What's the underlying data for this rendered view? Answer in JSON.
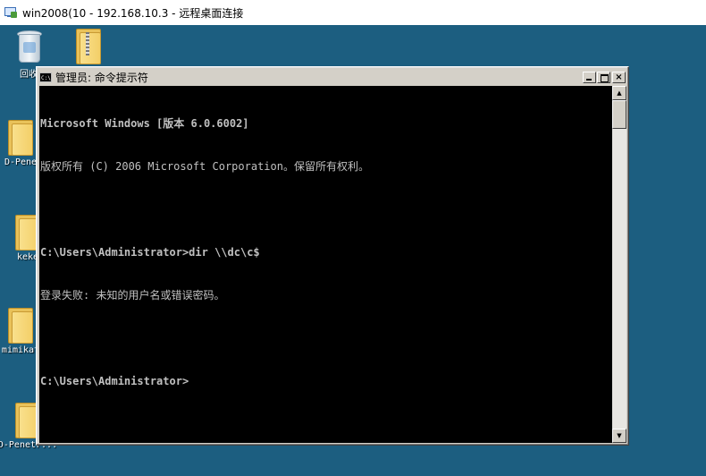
{
  "rdp": {
    "title": "win2008(10 - 192.168.10.3 - 远程桌面连接"
  },
  "desktop": {
    "background_color": "#1c5e80",
    "icons": [
      {
        "label": "回收",
        "icon": "recycle-bin-icon"
      },
      {
        "label": "",
        "icon": "zip-folder-icon"
      },
      {
        "label": "D-Pene",
        "icon": "folder-icon"
      },
      {
        "label": "keke",
        "icon": "folder-icon"
      },
      {
        "label": "mimikat",
        "icon": "folder-icon"
      },
      {
        "label": "D-Penetr...",
        "icon": "folder-icon"
      }
    ]
  },
  "cmd": {
    "title": "管理员: 命令提示符",
    "icon_text": "C:\\",
    "buttons": {
      "minimize": "minimize",
      "maximize": "maximize",
      "close": "×"
    },
    "lines": [
      "Microsoft Windows [版本 6.0.6002]",
      "版权所有 (C) 2006 Microsoft Corporation。保留所有权利。",
      "",
      "C:\\Users\\Administrator>dir \\\\dc\\c$",
      "登录失败: 未知的用户名或错误密码。",
      "",
      "C:\\Users\\Administrator>"
    ]
  },
  "scrollbar": {
    "up_arrow": "▲",
    "down_arrow": "▼"
  }
}
